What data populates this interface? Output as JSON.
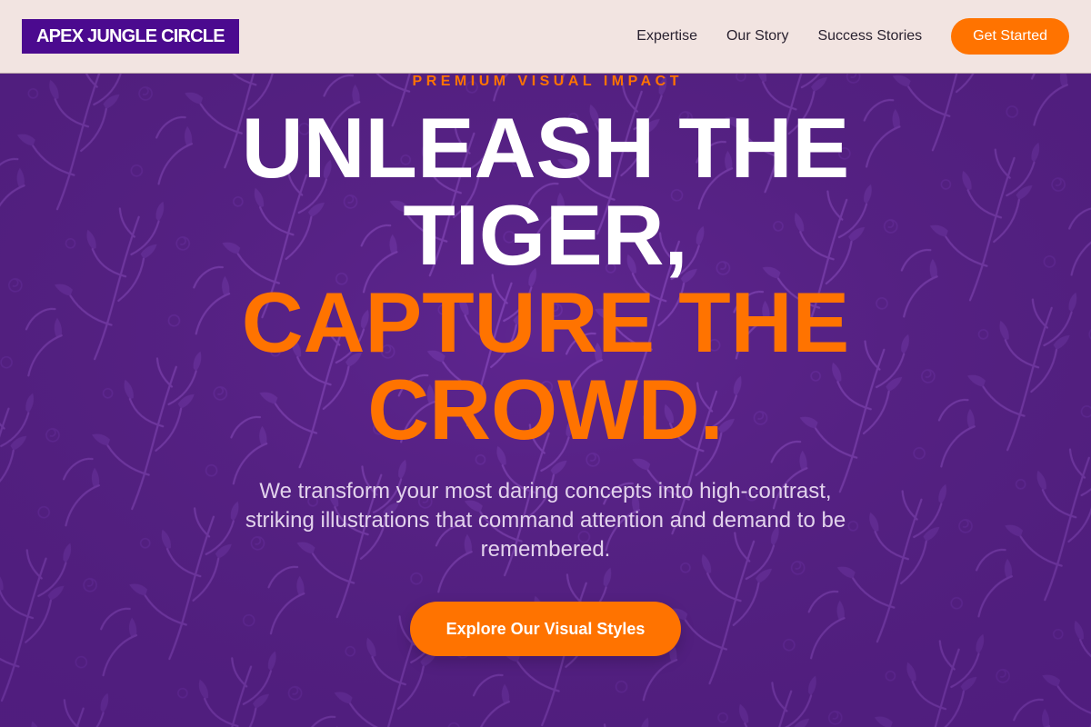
{
  "header": {
    "logo": "APEX JUNGLE CIRCLE",
    "nav": [
      "Expertise",
      "Our Story",
      "Success Stories"
    ],
    "cta": "Get Started"
  },
  "hero": {
    "eyebrow": "PREMIUM VISUAL IMPACT",
    "headline_white": "UNLEASH THE TIGER,",
    "headline_orange": "CAPTURE THE CROWD.",
    "subtext": "We transform your most daring concepts into high-contrast, striking illustrations that command attention and demand to be remembered.",
    "button": "Explore Our Visual Styles"
  },
  "colors": {
    "accent": "#ff7300",
    "brand": "#4b0a8f",
    "header_bg": "#f2e4e1",
    "hero_bg": "#5e2590"
  }
}
